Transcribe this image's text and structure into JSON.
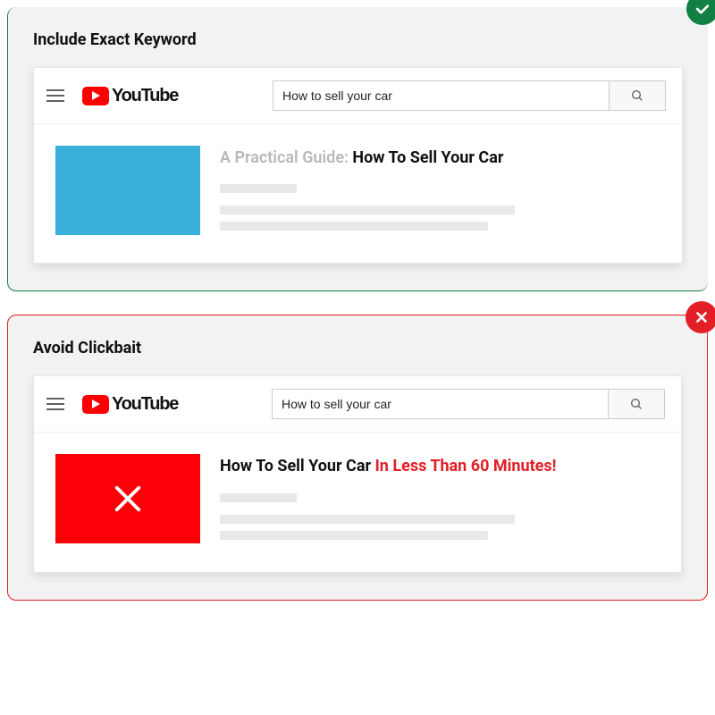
{
  "good_example": {
    "title": "Include Exact Keyword",
    "youtube_label": "YouTube",
    "search_value": "How to sell your car",
    "result_prefix": "A Practical Guide: ",
    "result_keyword": "How To Sell Your Car"
  },
  "bad_example": {
    "title": "Avoid Clickbait",
    "youtube_label": "YouTube",
    "search_value": "How to sell your car",
    "result_keyword": "How To Sell Your Car ",
    "result_clickbait": "In Less Than 60 Minutes!"
  }
}
